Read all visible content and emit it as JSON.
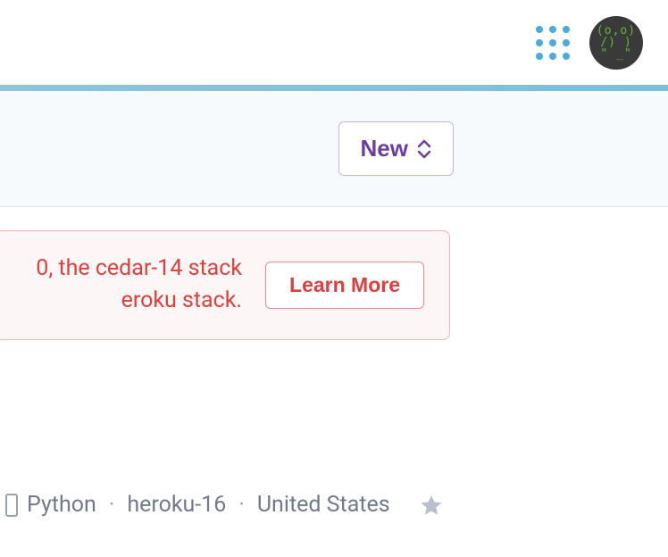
{
  "header": {
    "apps_menu_label": "app-launcher",
    "avatar_art_top": "(o,o)",
    "avatar_art_mid": "/)  )",
    "avatar_art_bot": "\" _\""
  },
  "subheader": {
    "new_button_label": "New"
  },
  "alert": {
    "line1": "0, the cedar-14 stack",
    "line2": "eroku stack.",
    "learn_more_label": "Learn More"
  },
  "app_row": {
    "language": "Python",
    "stack": "heroku-16",
    "region": "United States"
  }
}
